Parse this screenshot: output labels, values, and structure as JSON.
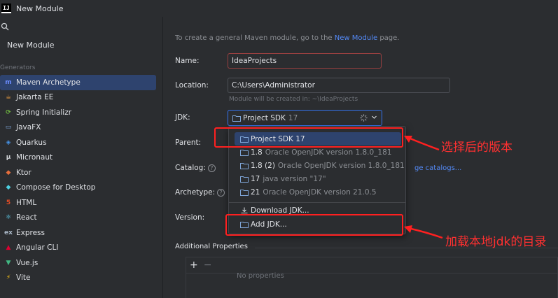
{
  "window": {
    "title": "New Module",
    "logo_text": "IJ"
  },
  "sidebar": {
    "new_module": "New Module",
    "generators_label": "Generators",
    "items": [
      {
        "label": "Maven Archetype",
        "icon": "maven-icon",
        "color": "#6b8cff",
        "glyph": "m"
      },
      {
        "label": "Jakarta EE",
        "icon": "jakarta-icon",
        "color": "#f0a040",
        "glyph": "☕"
      },
      {
        "label": "Spring Initializr",
        "icon": "spring-icon",
        "color": "#6db33f",
        "glyph": "⟳"
      },
      {
        "label": "JavaFX",
        "icon": "javafx-icon",
        "color": "#7ea4d6",
        "glyph": "▭"
      },
      {
        "label": "Quarkus",
        "icon": "quarkus-icon",
        "color": "#4695eb",
        "glyph": "◈"
      },
      {
        "label": "Micronaut",
        "icon": "micronaut-icon",
        "color": "#cfd2d6",
        "glyph": "μ"
      },
      {
        "label": "Ktor",
        "icon": "ktor-icon",
        "color": "#e66e3c",
        "glyph": "◆"
      },
      {
        "label": "Compose for Desktop",
        "icon": "compose-icon",
        "color": "#4dd0e1",
        "glyph": "◆"
      },
      {
        "label": "HTML",
        "icon": "html-icon",
        "color": "#e44d26",
        "glyph": "5"
      },
      {
        "label": "React",
        "icon": "react-icon",
        "color": "#61dafb",
        "glyph": "⚛"
      },
      {
        "label": "Express",
        "icon": "express-icon",
        "color": "#a9b7c6",
        "glyph": "ex"
      },
      {
        "label": "Angular CLI",
        "icon": "angular-icon",
        "color": "#dd0031",
        "glyph": "▲"
      },
      {
        "label": "Vue.js",
        "icon": "vue-icon",
        "color": "#41b883",
        "glyph": "▼"
      },
      {
        "label": "Vite",
        "icon": "vite-icon",
        "color": "#ffc517",
        "glyph": "⚡"
      }
    ]
  },
  "form": {
    "hint_prefix": "To create a general Maven module, go to the",
    "hint_link": "New Module",
    "hint_suffix": "page.",
    "name_label": "Name:",
    "name_value": "IdeaProjects",
    "location_label": "Location:",
    "location_value": "C:\\Users\\Administrator",
    "location_hint": "Module will be created in: ~\\IdeaProjects",
    "jdk_label": "JDK:",
    "jdk_value": "Project SDK",
    "jdk_version": "17",
    "parent_label": "Parent:",
    "catalog_label": "Catalog:",
    "catalog_link": "ge catalogs...",
    "archetype_label": "Archetype:",
    "version_label": "Version:",
    "help_glyph": "?",
    "additional_props": "Additional Properties",
    "add_btn": "+",
    "remove_btn": "−",
    "no_props": "No properties"
  },
  "jdk_dropdown": {
    "items": [
      {
        "name": "Project SDK 17",
        "detail": ""
      },
      {
        "name": "1.8",
        "detail": "Oracle OpenJDK version 1.8.0_181"
      },
      {
        "name": "1.8 (2)",
        "detail": "Oracle OpenJDK version 1.8.0_181"
      },
      {
        "name": "17",
        "detail": "java version \"17\""
      },
      {
        "name": "21",
        "detail": "Oracle OpenJDK version 21.0.5"
      }
    ],
    "download": "Download JDK...",
    "add": "Add JDK..."
  },
  "annotations": {
    "selected_version": "选择后的版本",
    "add_local_jdk": "加载本地jdk的目录",
    "color": "#ff2020"
  }
}
